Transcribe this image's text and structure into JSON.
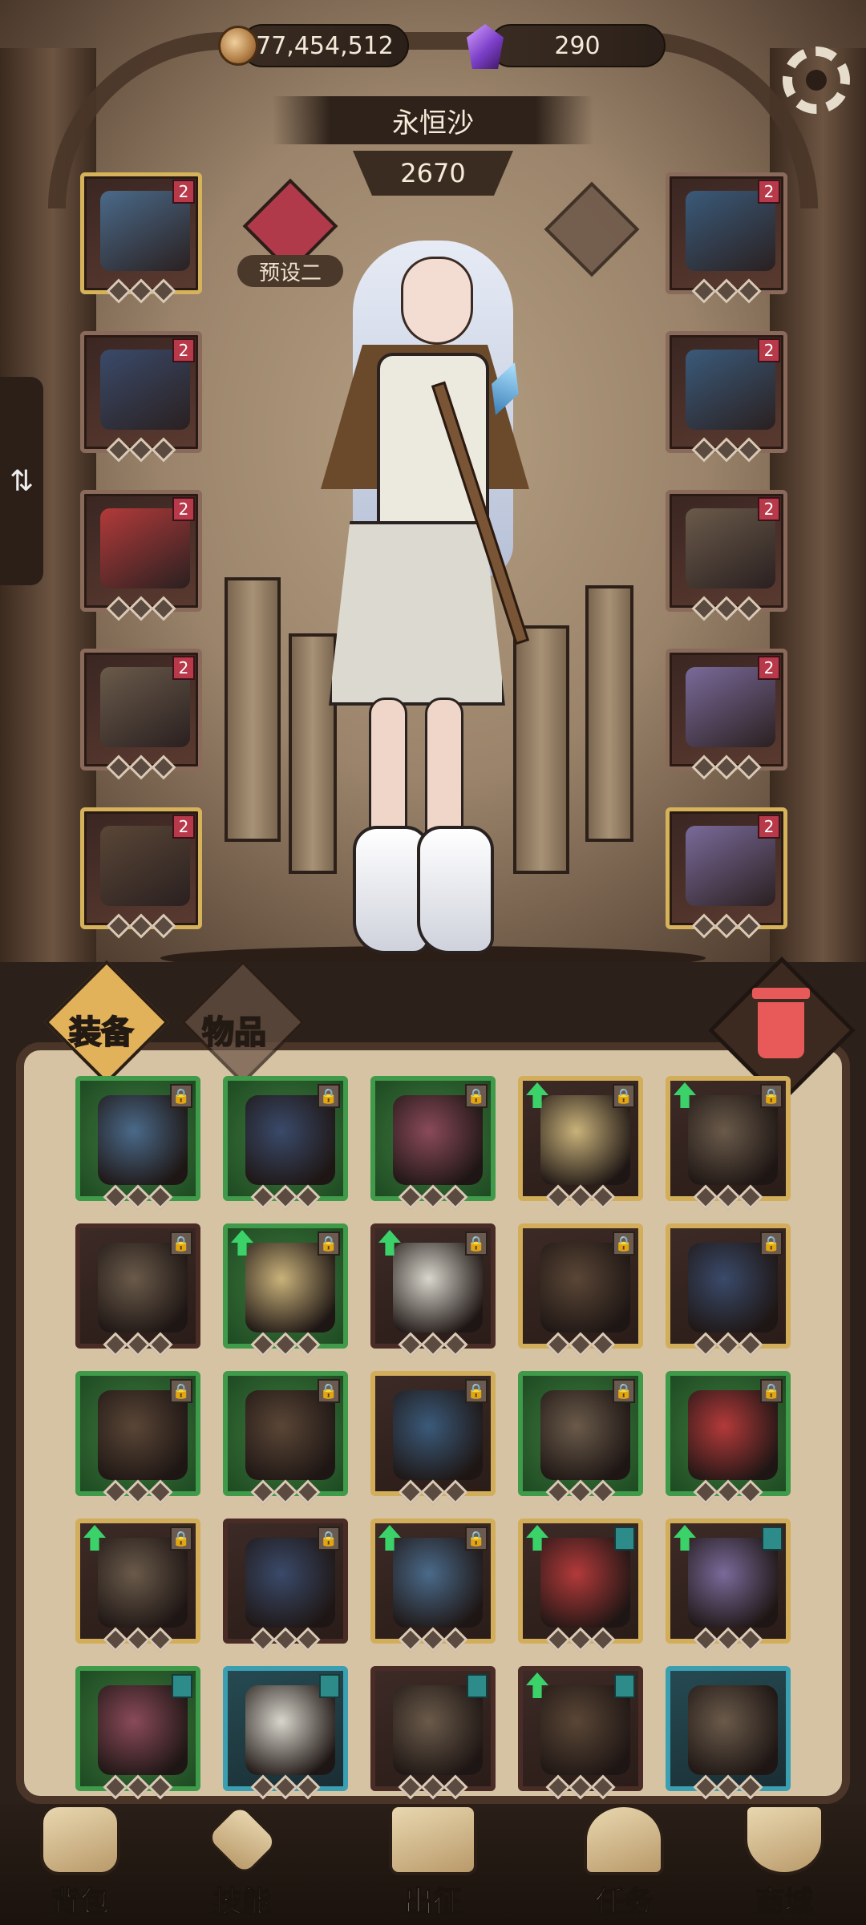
{
  "currency": {
    "coins": "77,454,512",
    "gems": "290"
  },
  "character": {
    "name": "永恒沙",
    "power": "2670"
  },
  "preset": {
    "label": "预设二"
  },
  "tabs": {
    "equipment": "装备",
    "items": "物品"
  },
  "nav": {
    "bag": "背包",
    "skills": "技能",
    "expedition": "出征",
    "tasks": "任务",
    "shop": "商城"
  },
  "equip_slots": {
    "left": [
      {
        "icon": "star-gauntlet-icon",
        "level": "2"
      },
      {
        "icon": "cloak-armor-icon",
        "level": "2"
      },
      {
        "icon": "white-gloves-icon",
        "level": "2"
      },
      {
        "icon": "white-shorts-icon",
        "level": "2"
      },
      {
        "icon": "winged-boots-icon",
        "level": "2"
      }
    ],
    "right": [
      {
        "icon": "amulet-icon",
        "level": "2"
      },
      {
        "icon": "gem-bracelet-icon",
        "level": "2"
      },
      {
        "icon": "ruby-ring-icon",
        "level": "2"
      },
      {
        "icon": "crystal-staff-icon",
        "level": "2"
      },
      {
        "icon": "spiked-helm-icon",
        "level": "2"
      }
    ]
  },
  "colors": {
    "accent": "#3bd26a",
    "level_badge": "#b83a4a",
    "panel": "#d6c3a4"
  },
  "inventory": [
    {
      "icon": "dark-hood-icon",
      "frame": "green",
      "up": false,
      "mark": "lock"
    },
    {
      "icon": "crowned-armor-icon",
      "frame": "green",
      "up": false,
      "mark": "lock"
    },
    {
      "icon": "potion-belt-icon",
      "frame": "green",
      "up": false,
      "mark": "lock"
    },
    {
      "icon": "spell-tome-icon",
      "frame": "gold",
      "up": true,
      "mark": "lock"
    },
    {
      "icon": "mace-staff-icon",
      "frame": "gold",
      "up": true,
      "mark": "lock"
    },
    {
      "icon": "white-hat-icon",
      "frame": "red",
      "up": false,
      "mark": "lock"
    },
    {
      "icon": "moon-circlet-icon",
      "frame": "green",
      "up": true,
      "mark": "lock"
    },
    {
      "icon": "twisted-wand-icon",
      "frame": "red",
      "up": true,
      "mark": "lock"
    },
    {
      "icon": "thorn-cuirass-icon",
      "frame": "gold",
      "up": false,
      "mark": "lock"
    },
    {
      "icon": "skull-pendant-icon",
      "frame": "gold",
      "up": false,
      "mark": "lock"
    },
    {
      "icon": "crystal-boots-icon",
      "frame": "green",
      "up": false,
      "mark": "lock"
    },
    {
      "icon": "feather-blade-icon",
      "frame": "green",
      "up": false,
      "mark": "lock"
    },
    {
      "icon": "dark-skirt-icon",
      "frame": "gold",
      "up": false,
      "mark": "lock"
    },
    {
      "icon": "buckle-pants-icon",
      "frame": "green",
      "up": false,
      "mark": "lock"
    },
    {
      "icon": "gem-necklace-icon",
      "frame": "green",
      "up": false,
      "mark": "lock"
    },
    {
      "icon": "golden-spear-icon",
      "frame": "gold",
      "up": true,
      "mark": "lock"
    },
    {
      "icon": "blue-rod-icon",
      "frame": "red",
      "up": false,
      "mark": "lock"
    },
    {
      "icon": "star-scepter-icon",
      "frame": "gold",
      "up": true,
      "mark": "lock"
    },
    {
      "icon": "hooded-mask-icon",
      "frame": "gold",
      "up": true,
      "mark": "tag"
    },
    {
      "icon": "fur-coat-icon",
      "frame": "gold",
      "up": true,
      "mark": "tag"
    },
    {
      "icon": "star-staff-icon",
      "frame": "green",
      "up": false,
      "mark": "tag"
    },
    {
      "icon": "moon-skirt-icon",
      "frame": "teal",
      "up": false,
      "mark": "tag"
    },
    {
      "icon": "white-greaves-icon",
      "frame": "red",
      "up": false,
      "mark": "tag"
    },
    {
      "icon": "blue-shield-icon",
      "frame": "red",
      "up": true,
      "mark": "tag"
    },
    {
      "icon": "ruby-ring-icon",
      "frame": "teal",
      "up": false,
      "mark": "none"
    }
  ]
}
